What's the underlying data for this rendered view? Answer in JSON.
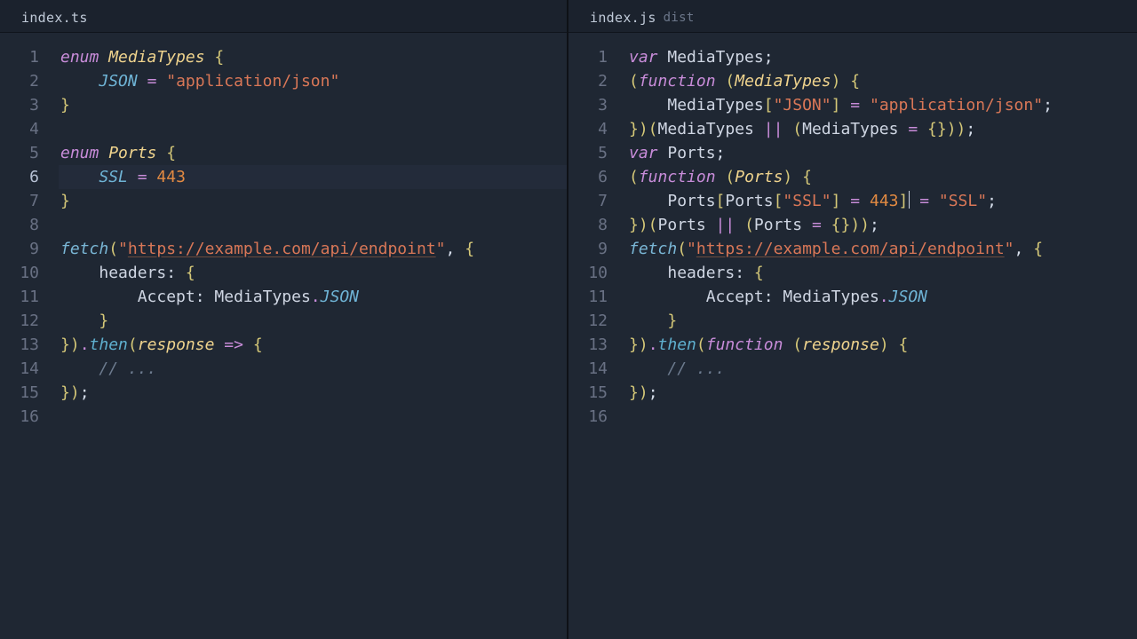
{
  "left": {
    "tab": {
      "name": "index.ts",
      "dist": ""
    },
    "highlighted_line": 6,
    "lines": [
      [
        [
          "kw",
          "enum "
        ],
        [
          "type",
          "MediaTypes "
        ],
        [
          "br",
          "{"
        ]
      ],
      [
        [
          "plain",
          "    "
        ],
        [
          "prop",
          "JSON"
        ],
        [
          "plain",
          " "
        ],
        [
          "op",
          "="
        ],
        [
          "plain",
          " "
        ],
        [
          "str",
          "\"application/json\""
        ]
      ],
      [
        [
          "br",
          "}"
        ]
      ],
      [],
      [
        [
          "kw",
          "enum "
        ],
        [
          "type",
          "Ports "
        ],
        [
          "br",
          "{"
        ]
      ],
      [
        [
          "plain",
          "    "
        ],
        [
          "prop",
          "SSL"
        ],
        [
          "plain",
          " "
        ],
        [
          "op",
          "="
        ],
        [
          "plain",
          " "
        ],
        [
          "num",
          "443"
        ]
      ],
      [
        [
          "br",
          "}"
        ]
      ],
      [],
      [
        [
          "fn",
          "fetch"
        ],
        [
          "br",
          "("
        ],
        [
          "str",
          "\""
        ],
        [
          "url",
          "https://example.com/api/endpoint"
        ],
        [
          "str",
          "\""
        ],
        [
          "pun",
          ", "
        ],
        [
          "br",
          "{"
        ]
      ],
      [
        [
          "plain",
          "    "
        ],
        [
          "ident",
          "headers"
        ],
        [
          "pun",
          ": "
        ],
        [
          "br",
          "{"
        ]
      ],
      [
        [
          "plain",
          "        "
        ],
        [
          "ident",
          "Accept"
        ],
        [
          "pun",
          ": "
        ],
        [
          "ident",
          "MediaTypes"
        ],
        [
          "dot",
          "."
        ],
        [
          "prop",
          "JSON"
        ]
      ],
      [
        [
          "plain",
          "    "
        ],
        [
          "br",
          "}"
        ]
      ],
      [
        [
          "br",
          "})"
        ],
        [
          "dot",
          "."
        ],
        [
          "fn2",
          "then"
        ],
        [
          "br",
          "("
        ],
        [
          "type",
          "response"
        ],
        [
          "plain",
          " "
        ],
        [
          "op",
          "=>"
        ],
        [
          "plain",
          " "
        ],
        [
          "br",
          "{"
        ]
      ],
      [
        [
          "plain",
          "    "
        ],
        [
          "cmt",
          "// ..."
        ]
      ],
      [
        [
          "br",
          "})"
        ],
        [
          "pun",
          ";"
        ]
      ],
      []
    ]
  },
  "right": {
    "tab": {
      "name": "index.js",
      "dist": "dist"
    },
    "caret_line": 7,
    "lines": [
      [
        [
          "kw",
          "var"
        ],
        [
          "plain",
          " "
        ],
        [
          "ident",
          "MediaTypes"
        ],
        [
          "pun",
          ";"
        ]
      ],
      [
        [
          "br",
          "("
        ],
        [
          "kw",
          "function "
        ],
        [
          "br",
          "("
        ],
        [
          "type",
          "MediaTypes"
        ],
        [
          "br",
          ") "
        ],
        [
          "br",
          "{"
        ]
      ],
      [
        [
          "plain",
          "    "
        ],
        [
          "ident",
          "MediaTypes"
        ],
        [
          "br",
          "["
        ],
        [
          "str",
          "\"JSON\""
        ],
        [
          "br",
          "]"
        ],
        [
          "plain",
          " "
        ],
        [
          "op",
          "="
        ],
        [
          "plain",
          " "
        ],
        [
          "str",
          "\"application/json\""
        ],
        [
          "pun",
          ";"
        ]
      ],
      [
        [
          "br",
          "})("
        ],
        [
          "ident",
          "MediaTypes"
        ],
        [
          "plain",
          " "
        ],
        [
          "op",
          "||"
        ],
        [
          "plain",
          " "
        ],
        [
          "br",
          "("
        ],
        [
          "ident",
          "MediaTypes"
        ],
        [
          "plain",
          " "
        ],
        [
          "op",
          "="
        ],
        [
          "plain",
          " "
        ],
        [
          "br",
          "{}))"
        ],
        [
          "pun",
          ";"
        ]
      ],
      [
        [
          "kw",
          "var"
        ],
        [
          "plain",
          " "
        ],
        [
          "ident",
          "Ports"
        ],
        [
          "pun",
          ";"
        ]
      ],
      [
        [
          "br",
          "("
        ],
        [
          "kw",
          "function "
        ],
        [
          "br",
          "("
        ],
        [
          "type",
          "Ports"
        ],
        [
          "br",
          ") "
        ],
        [
          "br",
          "{"
        ]
      ],
      [
        [
          "plain",
          "    "
        ],
        [
          "ident",
          "Ports"
        ],
        [
          "br",
          "["
        ],
        [
          "ident",
          "Ports"
        ],
        [
          "br",
          "["
        ],
        [
          "str",
          "\"SSL\""
        ],
        [
          "br",
          "]"
        ],
        [
          "plain",
          " "
        ],
        [
          "op",
          "="
        ],
        [
          "plain",
          " "
        ],
        [
          "num",
          "443"
        ],
        [
          "br",
          "]"
        ],
        [
          "plain",
          " "
        ],
        [
          "op",
          "="
        ],
        [
          "plain",
          " "
        ],
        [
          "str",
          "\"SSL\""
        ],
        [
          "pun",
          ";"
        ]
      ],
      [
        [
          "br",
          "})("
        ],
        [
          "ident",
          "Ports"
        ],
        [
          "plain",
          " "
        ],
        [
          "op",
          "||"
        ],
        [
          "plain",
          " "
        ],
        [
          "br",
          "("
        ],
        [
          "ident",
          "Ports"
        ],
        [
          "plain",
          " "
        ],
        [
          "op",
          "="
        ],
        [
          "plain",
          " "
        ],
        [
          "br",
          "{}))"
        ],
        [
          "pun",
          ";"
        ]
      ],
      [
        [
          "fn",
          "fetch"
        ],
        [
          "br",
          "("
        ],
        [
          "str",
          "\""
        ],
        [
          "url",
          "https://example.com/api/endpoint"
        ],
        [
          "str",
          "\""
        ],
        [
          "pun",
          ", "
        ],
        [
          "br",
          "{"
        ]
      ],
      [
        [
          "plain",
          "    "
        ],
        [
          "ident",
          "headers"
        ],
        [
          "pun",
          ": "
        ],
        [
          "br",
          "{"
        ]
      ],
      [
        [
          "plain",
          "        "
        ],
        [
          "ident",
          "Accept"
        ],
        [
          "pun",
          ": "
        ],
        [
          "ident",
          "MediaTypes"
        ],
        [
          "dot",
          "."
        ],
        [
          "prop",
          "JSON"
        ]
      ],
      [
        [
          "plain",
          "    "
        ],
        [
          "br",
          "}"
        ]
      ],
      [
        [
          "br",
          "})"
        ],
        [
          "dot",
          "."
        ],
        [
          "fn2",
          "then"
        ],
        [
          "br",
          "("
        ],
        [
          "kw",
          "function "
        ],
        [
          "br",
          "("
        ],
        [
          "type",
          "response"
        ],
        [
          "br",
          ") "
        ],
        [
          "br",
          "{"
        ]
      ],
      [
        [
          "plain",
          "    "
        ],
        [
          "cmt",
          "// ..."
        ]
      ],
      [
        [
          "br",
          "})"
        ],
        [
          "pun",
          ";"
        ]
      ],
      []
    ]
  }
}
